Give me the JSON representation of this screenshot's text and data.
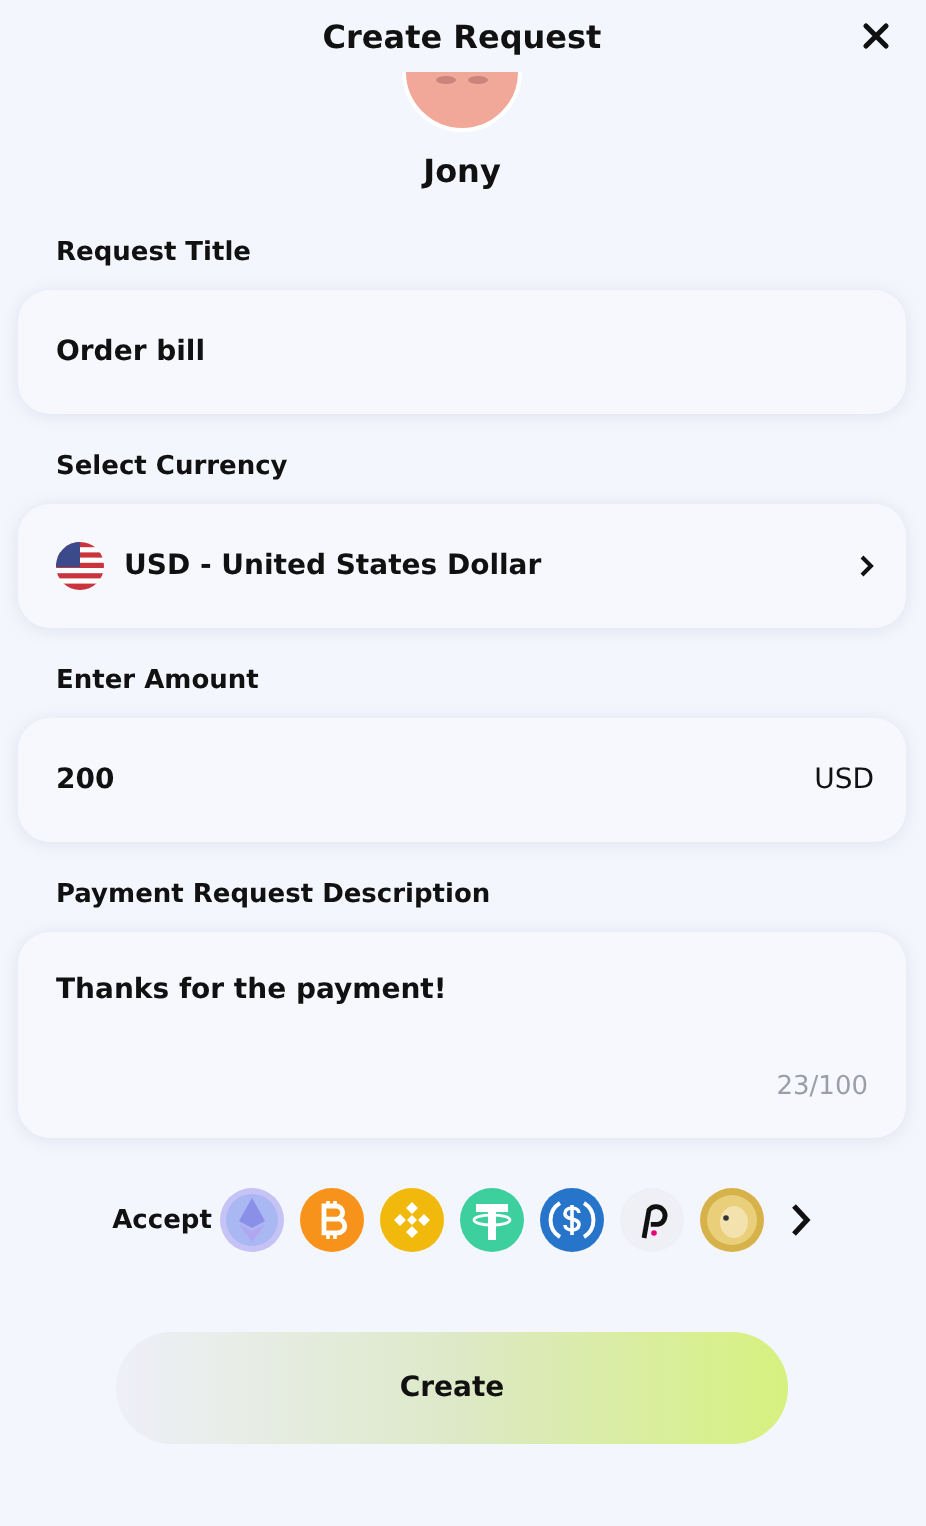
{
  "header": {
    "title": "Create Request"
  },
  "recipient": {
    "name": "Jony"
  },
  "fields": [
    {
      "kind": "text",
      "label": "Request Title",
      "value": "Order bill"
    },
    {
      "kind": "select",
      "label": "Select Currency",
      "value": "USD - United States Dollar"
    },
    {
      "kind": "amount",
      "label": "Enter Amount",
      "value": "200",
      "unit": "USD"
    },
    {
      "kind": "textarea",
      "label": "Payment Request Description",
      "value": "Thanks for the payment!",
      "counter": "23/100"
    }
  ],
  "accept": {
    "label": "Accept"
  },
  "submit": {
    "label": "Create"
  }
}
